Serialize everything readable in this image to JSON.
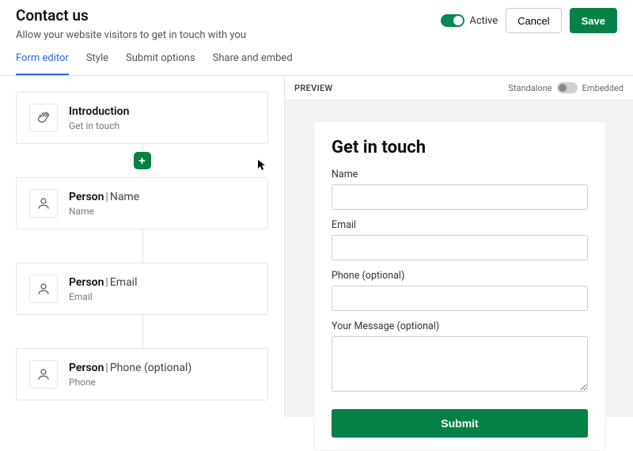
{
  "header": {
    "title": "Contact us",
    "description": "Allow your website visitors to get in touch with you",
    "active_label": "Active",
    "cancel_label": "Cancel",
    "save_label": "Save"
  },
  "tabs": {
    "form_editor": "Form editor",
    "style": "Style",
    "submit_options": "Submit options",
    "share_embed": "Share and embed"
  },
  "blocks": {
    "intro": {
      "title": "Introduction",
      "sub": "Get in touch"
    },
    "name": {
      "entity": "Person",
      "field": "Name",
      "sub": "Name"
    },
    "email": {
      "entity": "Person",
      "field": "Email",
      "sub": "Email"
    },
    "phone": {
      "entity": "Person",
      "field": "Phone (optional)",
      "sub": "Phone"
    }
  },
  "add_label": "+",
  "preview": {
    "header_label": "PREVIEW",
    "mode_standalone": "Standalone",
    "mode_embedded": "Embedded",
    "form_title": "Get in touch",
    "labels": {
      "name": "Name",
      "email": "Email",
      "phone": "Phone (optional)",
      "message": "Your Message (optional)"
    },
    "submit_label": "Submit"
  }
}
